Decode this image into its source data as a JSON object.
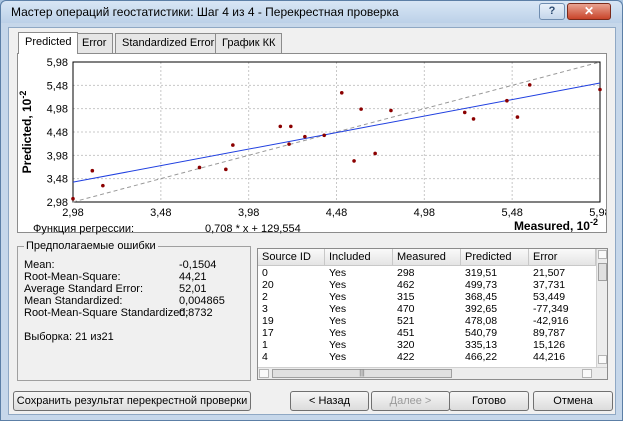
{
  "window": {
    "title": "Мастер операций геостатистики: Шаг 4 из 4 - Перекрестная проверка",
    "help_label": "?",
    "close_label": "✕"
  },
  "tabs": [
    {
      "label": "Predicted",
      "active": true
    },
    {
      "label": "Error",
      "active": false
    },
    {
      "label": "Standardized Error",
      "active": false
    },
    {
      "label": "График КК",
      "active": false
    }
  ],
  "chart_data": {
    "type": "scatter",
    "xlabel": "Measured, 10",
    "xlabel_exp": "-2",
    "ylabel": "Predicted, 10",
    "ylabel_exp": "-2",
    "xlim": [
      2.98,
      5.98
    ],
    "ylim": [
      2.98,
      5.98
    ],
    "x_ticks": [
      "2,98",
      "3,48",
      "3,98",
      "4,48",
      "4,98",
      "5,48",
      "5,98"
    ],
    "y_ticks": [
      "2,98",
      "3,48",
      "3,98",
      "4,48",
      "4,98",
      "5,48",
      "5,98"
    ],
    "grid": true,
    "regression": {
      "slope": 0.708,
      "intercept": 1.29554,
      "color": "#1f3fe0"
    },
    "reference_line": {
      "slope": 1,
      "intercept": 0,
      "color": "#999999",
      "style": "dashed"
    },
    "points": {
      "color": "#8b0000",
      "x": [
        2.98,
        3.09,
        3.15,
        3.7,
        3.85,
        3.89,
        4.16,
        4.21,
        4.22,
        4.3,
        4.41,
        4.51,
        4.58,
        4.62,
        4.7,
        4.79,
        5.21,
        5.26,
        5.45,
        5.51,
        5.58,
        5.98
      ],
      "y": [
        3.05,
        3.65,
        3.33,
        3.72,
        3.68,
        4.2,
        4.6,
        4.22,
        4.6,
        4.38,
        4.41,
        5.32,
        3.86,
        4.97,
        4.02,
        4.94,
        4.9,
        4.76,
        5.15,
        4.8,
        5.49,
        5.39
      ]
    }
  },
  "regression": {
    "label": "Функция регрессии:",
    "formula": "0,708 * x + 129,554"
  },
  "errors": {
    "title": "Предполагаемые ошибки",
    "rows": [
      {
        "label": "Mean:",
        "value": "-0,1504"
      },
      {
        "label": "Root-Mean-Square:",
        "value": "44,21"
      },
      {
        "label": "Average Standard Error:",
        "value": "52,01"
      },
      {
        "label": "Mean Standardized:",
        "value": "0,004865"
      },
      {
        "label": "Root-Mean-Square Standardized:",
        "value": "0,8732"
      }
    ],
    "sample": "Выборка: 21 из21"
  },
  "table": {
    "columns": [
      "Source ID",
      "Included",
      "Measured",
      "Predicted",
      "Error"
    ],
    "rows": [
      [
        "0",
        "Yes",
        "298",
        "319,51",
        "21,507"
      ],
      [
        "20",
        "Yes",
        "462",
        "499,73",
        "37,731"
      ],
      [
        "2",
        "Yes",
        "315",
        "368,45",
        "53,449"
      ],
      [
        "3",
        "Yes",
        "470",
        "392,65",
        "-77,349"
      ],
      [
        "19",
        "Yes",
        "521",
        "478,08",
        "-42,916"
      ],
      [
        "17",
        "Yes",
        "451",
        "540,79",
        "89,787"
      ],
      [
        "1",
        "Yes",
        "320",
        "335,13",
        "15,126"
      ],
      [
        "4",
        "Yes",
        "422",
        "466,22",
        "44,216"
      ]
    ],
    "scroll_thumb_glyph": "|||"
  },
  "buttons": {
    "save": "Сохранить результат перекрестной проверки",
    "back": "< Назад",
    "next": "Далее >",
    "finish": "Готово",
    "cancel": "Отмена"
  }
}
